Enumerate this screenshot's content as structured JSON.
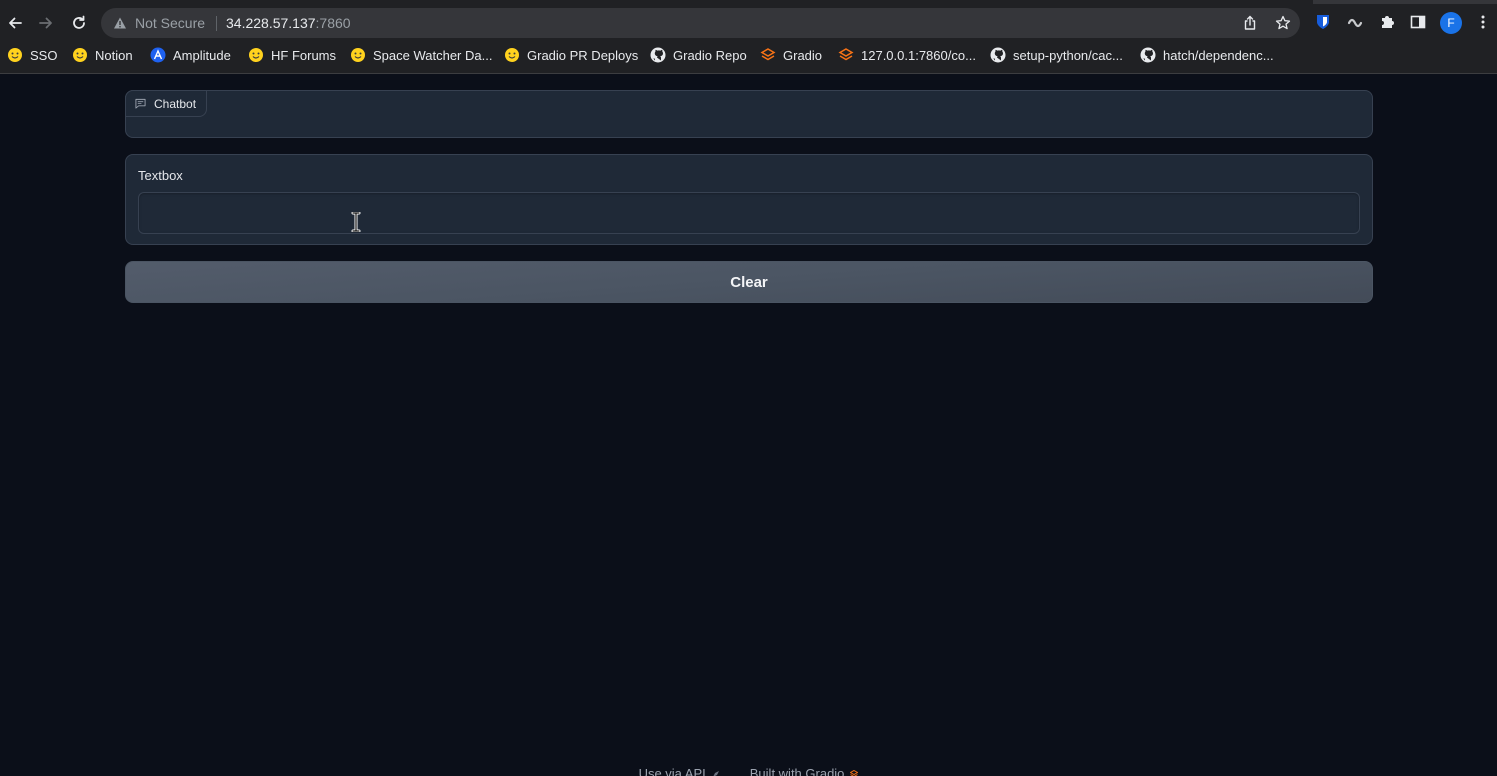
{
  "browser": {
    "security_label": "Not Secure",
    "url_host": "34.228.57.137",
    "url_port": ":7860",
    "profile_initial": "F",
    "bookmarks": [
      {
        "label": "SSO",
        "icon": "hugging-face-icon"
      },
      {
        "label": "Notion",
        "icon": "hugging-face-icon"
      },
      {
        "label": "Amplitude",
        "icon": "amplitude-icon"
      },
      {
        "label": "HF Forums",
        "icon": "hugging-face-icon"
      },
      {
        "label": "Space Watcher Da...",
        "icon": "hugging-face-icon"
      },
      {
        "label": "Gradio PR Deploys",
        "icon": "hugging-face-icon"
      },
      {
        "label": "Gradio Repo",
        "icon": "github-icon"
      },
      {
        "label": "Gradio",
        "icon": "gradio-icon"
      },
      {
        "label": "127.0.0.1:7860/co...",
        "icon": "gradio-icon"
      },
      {
        "label": "setup-python/cac...",
        "icon": "github-icon"
      },
      {
        "label": "hatch/dependenc...",
        "icon": "github-icon"
      }
    ]
  },
  "app": {
    "chatbot_label": "Chatbot",
    "textbox_label": "Textbox",
    "textbox_value": "",
    "clear_label": "Clear"
  },
  "footer": {
    "api_label": "Use via API",
    "built_label": "Built with Gradio"
  },
  "colors": {
    "background": "#0b0f19",
    "block": "#1f2937",
    "border": "#374151",
    "button": "#4b5563",
    "gradio_accent": "#f97316"
  }
}
